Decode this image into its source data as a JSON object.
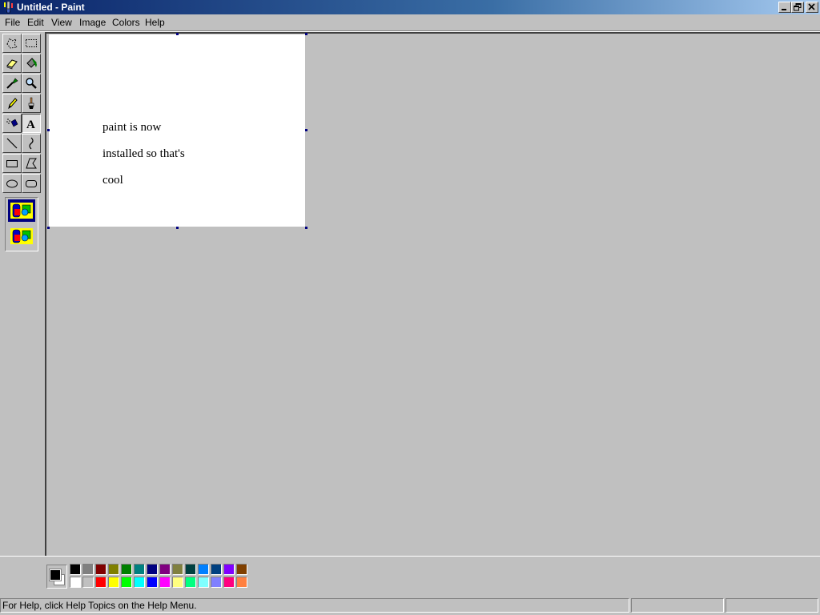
{
  "window": {
    "title": "Untitled - Paint",
    "controls": [
      "minimize",
      "restore",
      "close"
    ]
  },
  "menu": {
    "items": [
      "File",
      "Edit",
      "View",
      "Image",
      "Colors",
      "Help"
    ]
  },
  "toolbox": {
    "tools": [
      {
        "name": "free-form-select",
        "icon": "free-form-select-icon"
      },
      {
        "name": "select",
        "icon": "rectangle-select-icon"
      },
      {
        "name": "eraser",
        "icon": "eraser-icon"
      },
      {
        "name": "fill-with-color",
        "icon": "paint-bucket-icon"
      },
      {
        "name": "pick-color",
        "icon": "eyedropper-icon"
      },
      {
        "name": "magnifier",
        "icon": "magnifier-icon"
      },
      {
        "name": "pencil",
        "icon": "pencil-icon"
      },
      {
        "name": "brush",
        "icon": "brush-icon"
      },
      {
        "name": "airbrush",
        "icon": "airbrush-icon"
      },
      {
        "name": "text",
        "icon": "text-icon",
        "active": true
      },
      {
        "name": "line",
        "icon": "line-icon"
      },
      {
        "name": "curve",
        "icon": "curve-icon"
      },
      {
        "name": "rectangle",
        "icon": "rectangle-icon"
      },
      {
        "name": "polygon",
        "icon": "polygon-icon"
      },
      {
        "name": "ellipse",
        "icon": "ellipse-icon"
      },
      {
        "name": "rounded-rectangle",
        "icon": "rounded-rectangle-icon"
      }
    ],
    "text_options": [
      "opaque-background-icon",
      "transparent-background-icon"
    ],
    "selected_option": "opaque-background-icon"
  },
  "canvas": {
    "lines": [
      "paint is now",
      "installed so that's",
      "cool"
    ]
  },
  "palette": {
    "foreground": "#000000",
    "background": "#ffffff",
    "row1": [
      "#000000",
      "#808080",
      "#800000",
      "#808000",
      "#008000",
      "#008080",
      "#000080",
      "#800080",
      "#808040",
      "#004040",
      "#0080ff",
      "#004080",
      "#8000ff",
      "#804000"
    ],
    "row2": [
      "#ffffff",
      "#c0c0c0",
      "#ff0000",
      "#ffff00",
      "#00ff00",
      "#00ffff",
      "#0000ff",
      "#ff00ff",
      "#ffff80",
      "#00ff80",
      "#80ffff",
      "#8080ff",
      "#ff0080",
      "#ff8040"
    ]
  },
  "status": {
    "help_text": "For Help, click Help Topics on the Help Menu.",
    "position": "",
    "size": ""
  }
}
